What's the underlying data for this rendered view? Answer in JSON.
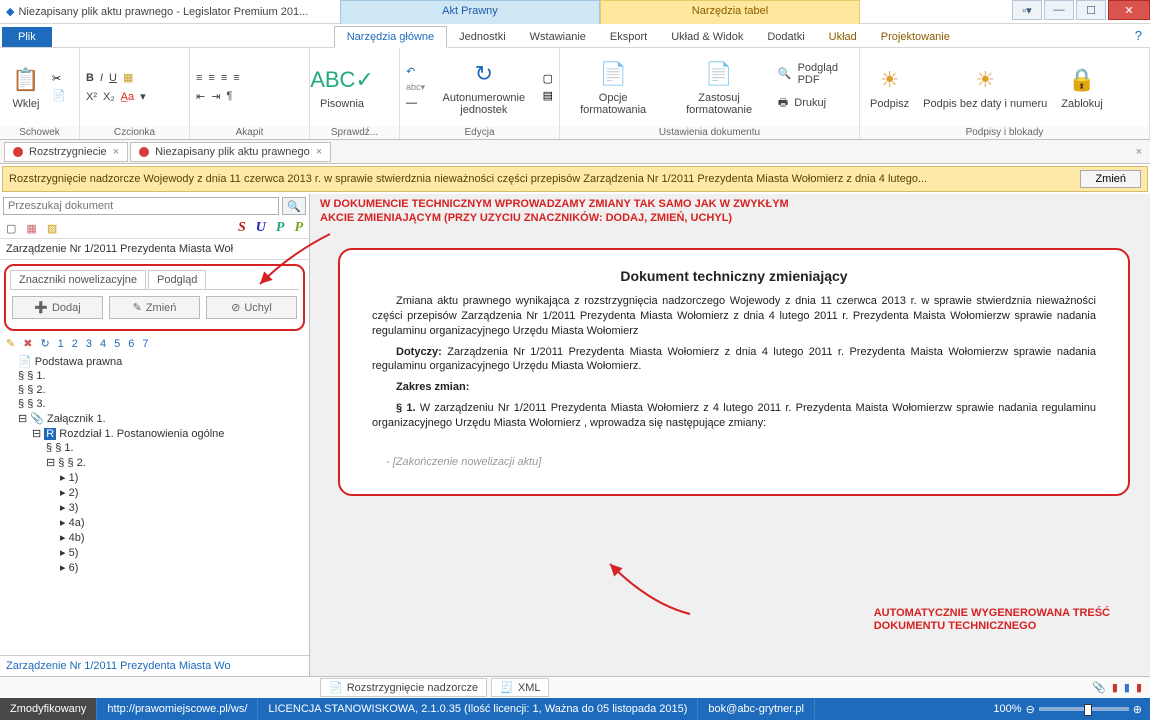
{
  "titlebar": {
    "doc_title": "Niezapisany plik aktu prawnego - Legislator Premium 201...",
    "context_tab_blue": "Akt Prawny",
    "context_tab_yellow": "Narzędzia tabel"
  },
  "menu": {
    "plik": "Plik",
    "tabs": [
      "Narzędzia główne",
      "Jednostki",
      "Wstawianie",
      "Eksport",
      "Układ & Widok",
      "Dodatki",
      "Układ",
      "Projektowanie"
    ]
  },
  "ribbon": {
    "schowek": {
      "wklej": "Wklej",
      "group": "Schowek"
    },
    "czcionka": {
      "group": "Czcionka"
    },
    "akapit": {
      "group": "Akapit"
    },
    "sprawdz": {
      "pisownia": "Pisownia",
      "group": "Sprawdź..."
    },
    "edycja": {
      "autonum": "Autonumerownie jednostek",
      "group": "Edycja"
    },
    "ustaw": {
      "opcje": "Opcje formatowania",
      "zastosuj": "Zastosuj formatowanie",
      "podglad": "Podgląd PDF",
      "drukuj": "Drukuj",
      "group": "Ustawienia dokumentu"
    },
    "podpisy": {
      "podpisz": "Podpisz",
      "podpisbez": "Podpis bez daty i numeru",
      "zablokuj": "Zablokuj",
      "group": "Podpisy i blokady"
    }
  },
  "doctabs": {
    "t1": "Rozstrzygniecie",
    "t2": "Niezapisany plik aktu prawnego"
  },
  "notice": {
    "text": "Rozstrzygnięcie nadzorcze Wojewody z dnia 11 czerwca 2013 r. w sprawie stwierdznia nieważności części przepisów Zarządzenia Nr 1/2011 Prezydenta Miasta Wołomierz z dnia 4 lutego...",
    "btn": "Zmień"
  },
  "left": {
    "search_placeholder": "Przeszukaj dokument",
    "doc_label": "Zarządzenie Nr 1/2011 Prezydenta Miasta Woł",
    "markers": {
      "tab1": "Znaczniki nowelizacyjne",
      "tab2": "Podgląd",
      "dodaj": "Dodaj",
      "zmien": "Zmień",
      "uchyl": "Uchyl"
    },
    "numbers": [
      "1",
      "2",
      "3",
      "4",
      "5",
      "6",
      "7"
    ],
    "tree": {
      "n0": "Podstawa prawna",
      "n1": "§ 1.",
      "n2": "§ 2.",
      "n3": "§ 3.",
      "n4": "Załącznik 1.",
      "n5": "Rozdział 1. Postanowienia ogólne",
      "n6": "§ 1.",
      "n7": "§ 2.",
      "n8": "1)",
      "n9": "2)",
      "n10": "3)",
      "n11": "4a)",
      "n12": "4b)",
      "n13": "5)",
      "n14": "6)"
    },
    "link": "Zarządzenie Nr 1/2011 Prezydenta Miasta Wo"
  },
  "annot": {
    "top_l1": "W DOKUMENCIE TECHNICZNYM WPROWADZAMY ZMIANY TAK SAMO JAK W ZWYKŁYM",
    "top_l2": "AKCIE ZMIENIAJĄCYM (PRZY UZYCIU ZNACZNIKÓW: DODAJ, ZMIEŃ, UCHYL)",
    "bot_l1": "AUTOMATYCZNIE WYGENEROWANA TREŚĆ",
    "bot_l2": "DOKUMENTU TECHNICZNEGO"
  },
  "doc": {
    "title": "Dokument techniczny zmieniający",
    "p1": "Zmiana aktu prawnego wynikająca z rozstrzygnięcia nadzorczego Wojewody z dnia 11 czerwca 2013 r. w sprawie stwierdznia nieważności części przepisów Zarządzenia Nr 1/2011 Prezydenta Miasta Wołomierz z dnia 4 lutego 2011 r. Prezydenta Maista Wołomierzw sprawie nadania regulaminu organizacyjnego Urzędu Miasta Wołomierz",
    "p2a": "Dotyczy: ",
    "p2b": "Zarządzenia Nr 1/2011 Prezydenta Miasta Wołomierz z dnia 4 lutego 2011 r. Prezydenta Maista Wołomierzw sprawie nadania regulaminu organizacyjnego Urzędu Miasta Wołomierz.",
    "p3": "Zakres zmian:",
    "p4a": "§ 1. ",
    "p4b": "W zarządzeniu Nr 1/2011 Prezydenta Miasta Wołomierz z 4 lutego 2011 r. Prezydenta Maista Wołomierzw sprawie nadania regulaminu organizacyjnego Urzędu Miasta Wołomierz , wprowadza się następujące zmiany:",
    "place": "-  [Zakończenie nowelizacji aktu]"
  },
  "bottomtabs": {
    "t1": "Rozstrzygnięcie nadzorcze",
    "t2": "XML"
  },
  "status": {
    "s1": "Zmodyfikowany",
    "s2": "http://prawomiejscowe.pl/ws/",
    "s3": "LICENCJA STANOWISKOWA, 2.1.0.35 (Ilość licencji: 1, Ważna do 05 listopada 2015)",
    "s4": "bok@abc-grytner.pl",
    "zoom": "100%"
  }
}
